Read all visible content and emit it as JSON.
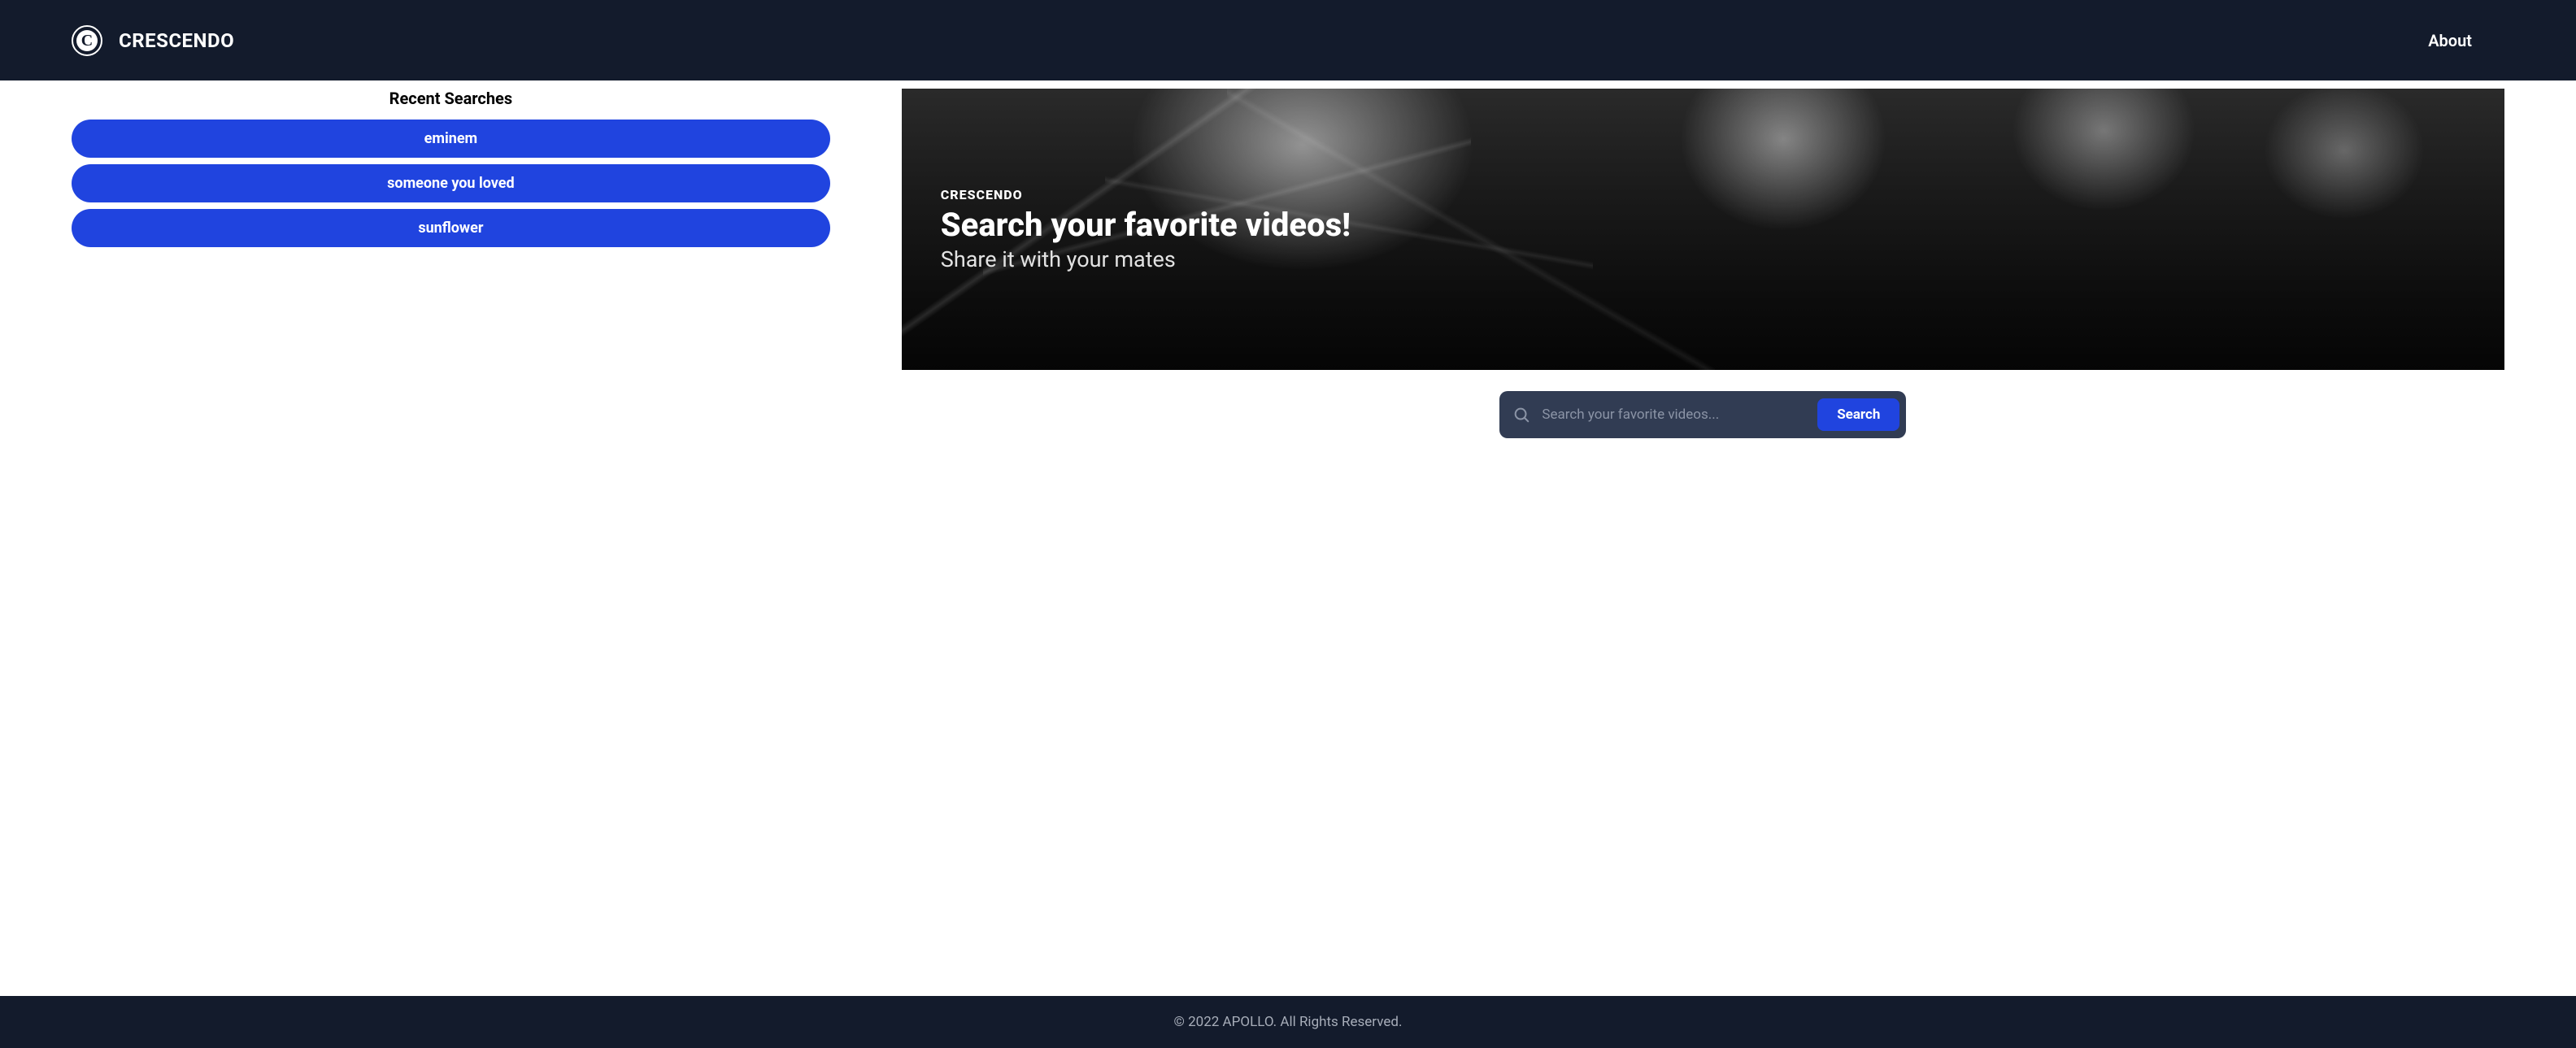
{
  "header": {
    "brand_name": "CRESCENDO",
    "logo_letter": "C",
    "nav": {
      "about": "About"
    }
  },
  "sidebar": {
    "title": "Recent Searches",
    "items": [
      {
        "label": "eminem"
      },
      {
        "label": "someone you loved"
      },
      {
        "label": "sunflower"
      }
    ]
  },
  "hero": {
    "eyebrow": "CRESCENDO",
    "title": "Search your favorite videos!",
    "subtitle": "Share it with your mates"
  },
  "search": {
    "placeholder": "Search your favorite videos...",
    "value": "",
    "button_label": "Search"
  },
  "footer": {
    "text": "© 2022 APOLLO. All Rights Reserved."
  },
  "colors": {
    "header_bg": "#131b2c",
    "accent": "#2044df",
    "searchbar_bg": "#313c53"
  }
}
